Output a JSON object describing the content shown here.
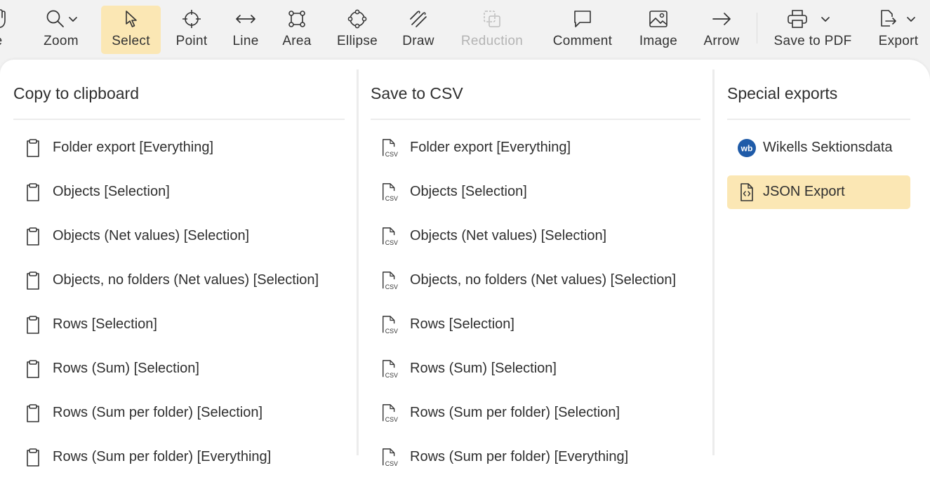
{
  "toolbar": {
    "items": [
      {
        "label": "ove",
        "icon": "hand-icon"
      },
      {
        "label": "Zoom",
        "icon": "zoom-icon"
      },
      {
        "label": "Select",
        "icon": "select-cursor-icon",
        "active": true
      },
      {
        "label": "Point",
        "icon": "crosshair-icon"
      },
      {
        "label": "Line",
        "icon": "line-icon"
      },
      {
        "label": "Area",
        "icon": "area-icon"
      },
      {
        "label": "Ellipse",
        "icon": "ellipse-icon"
      },
      {
        "label": "Draw",
        "icon": "draw-icon"
      },
      {
        "label": "Reduction",
        "icon": "reduction-icon",
        "disabled": true
      },
      {
        "label": "Comment",
        "icon": "comment-icon"
      },
      {
        "label": "Image",
        "icon": "image-icon"
      },
      {
        "label": "Arrow",
        "icon": "arrow-icon"
      },
      {
        "label": "Save to PDF",
        "icon": "printer-icon"
      },
      {
        "label": "Export",
        "icon": "export-icon"
      }
    ]
  },
  "export_menu": {
    "clipboard": {
      "title": "Copy to clipboard",
      "icon": "clipboard-icon",
      "items": [
        "Folder export [Everything]",
        "Objects [Selection]",
        "Objects (Net values) [Selection]",
        "Objects, no folders (Net values) [Selection]",
        "Rows [Selection]",
        "Rows (Sum) [Selection]",
        "Rows (Sum per folder) [Selection]",
        "Rows (Sum per folder) [Everything]"
      ]
    },
    "csv": {
      "title": "Save to CSV",
      "icon": "csv-file-icon",
      "icon_text": "CSV",
      "items": [
        "Folder export [Everything]",
        "Objects [Selection]",
        "Objects (Net values) [Selection]",
        "Objects, no folders (Net values) [Selection]",
        "Rows [Selection]",
        "Rows (Sum) [Selection]",
        "Rows (Sum per folder) [Selection]",
        "Rows (Sum per folder) [Everything]"
      ]
    },
    "special": {
      "title": "Special exports",
      "items": [
        {
          "label": "Wikells Sektionsdata",
          "icon": "wikells-logo-icon",
          "logo_text": "wb"
        },
        {
          "label": "JSON Export",
          "icon": "json-file-icon",
          "highlighted": true
        }
      ]
    }
  },
  "colors": {
    "active_bg": "#fbe7b4",
    "highlight_bg": "#fbe7b4",
    "panel_bg": "#ffffff",
    "toolbar_bg": "#f2f2f2",
    "wikells_blue": "#1f5ba8",
    "disabled_text": "#b4b4b4"
  }
}
